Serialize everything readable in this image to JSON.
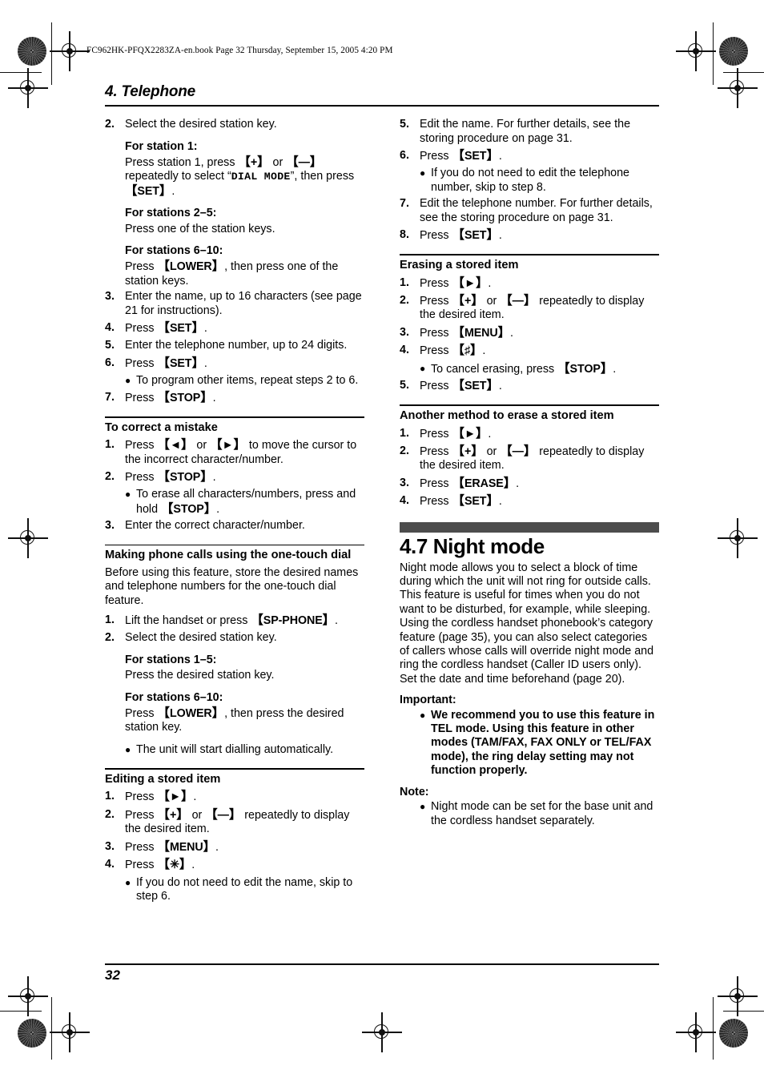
{
  "book_header": "FC962HK-PFQX2283ZA-en.book  Page 32  Thursday, September 15, 2005  4:20 PM",
  "chapter": {
    "title": "4. Telephone"
  },
  "folio": "32",
  "colors": {
    "feature_bar": "#4d4d4d",
    "rule": "#000000",
    "text": "#000000"
  },
  "keys": {
    "set": "SET",
    "stop": "STOP",
    "lower": "LOWER",
    "menu": "MENU",
    "erase": "ERASE",
    "sp_phone": "SP-PHONE",
    "plus": "+",
    "minus": "—",
    "left": "◄",
    "right": "►",
    "star": "✳",
    "hash": "♯"
  },
  "left_column": {
    "continued_steps": [
      {
        "num": "2.",
        "text": "Select the desired station key.",
        "substeps": [
          {
            "head": "For station 1:",
            "body_parts": [
              {
                "t": "text",
                "v": "Press station 1, press "
              },
              {
                "t": "key",
                "v": "+"
              },
              {
                "t": "text",
                "v": " or "
              },
              {
                "t": "key",
                "v": "—"
              },
              {
                "t": "text",
                "v": " repeatedly to select “"
              },
              {
                "t": "mono",
                "v": "DIAL MODE"
              },
              {
                "t": "text",
                "v": "”, then press "
              },
              {
                "t": "key",
                "v": "SET"
              },
              {
                "t": "text",
                "v": "."
              }
            ]
          },
          {
            "head": "For stations 2–5:",
            "body_parts": [
              {
                "t": "text",
                "v": "Press one of the station keys."
              }
            ]
          },
          {
            "head": "For stations 6–10:",
            "body_parts": [
              {
                "t": "text",
                "v": "Press "
              },
              {
                "t": "key",
                "v": "LOWER"
              },
              {
                "t": "text",
                "v": ", then press one of the station keys."
              }
            ]
          }
        ]
      },
      {
        "num": "3.",
        "text": "Enter the name, up to 16 characters (see page 21 for instructions)."
      },
      {
        "num": "4.",
        "parts": [
          {
            "t": "text",
            "v": "Press "
          },
          {
            "t": "key",
            "v": "SET"
          },
          {
            "t": "text",
            "v": "."
          }
        ]
      },
      {
        "num": "5.",
        "text": "Enter the telephone number, up to 24 digits."
      },
      {
        "num": "6.",
        "parts": [
          {
            "t": "text",
            "v": "Press "
          },
          {
            "t": "key",
            "v": "SET"
          },
          {
            "t": "text",
            "v": "."
          }
        ],
        "bullets": [
          {
            "parts": [
              {
                "t": "text",
                "v": "To program other items, repeat steps 2 to 6."
              }
            ]
          }
        ]
      },
      {
        "num": "7.",
        "parts": [
          {
            "t": "text",
            "v": "Press "
          },
          {
            "t": "key",
            "v": "STOP"
          },
          {
            "t": "text",
            "v": "."
          }
        ]
      }
    ],
    "sections": [
      {
        "heading": "To correct a mistake",
        "steps": [
          {
            "num": "1.",
            "parts": [
              {
                "t": "text",
                "v": "Press "
              },
              {
                "t": "key",
                "v": "◄"
              },
              {
                "t": "text",
                "v": " or "
              },
              {
                "t": "key",
                "v": "►"
              },
              {
                "t": "text",
                "v": " to move the cursor to the incorrect character/number."
              }
            ]
          },
          {
            "num": "2.",
            "parts": [
              {
                "t": "text",
                "v": "Press "
              },
              {
                "t": "key",
                "v": "STOP"
              },
              {
                "t": "text",
                "v": "."
              }
            ],
            "bullets": [
              {
                "parts": [
                  {
                    "t": "text",
                    "v": "To erase all characters/numbers, press and hold "
                  },
                  {
                    "t": "key",
                    "v": "STOP"
                  },
                  {
                    "t": "text",
                    "v": "."
                  }
                ]
              }
            ]
          },
          {
            "num": "3.",
            "text": "Enter the correct character/number."
          }
        ]
      },
      {
        "heading": "Making phone calls using the one-touch dial",
        "intro": "Before using this feature, store the desired names and telephone numbers for the one-touch dial feature.",
        "steps": [
          {
            "num": "1.",
            "parts": [
              {
                "t": "text",
                "v": "Lift the handset or press "
              },
              {
                "t": "key",
                "v": "SP-PHONE"
              },
              {
                "t": "text",
                "v": "."
              }
            ]
          },
          {
            "num": "2.",
            "text": "Select the desired station key.",
            "substeps": [
              {
                "head": "For stations 1–5:",
                "body_parts": [
                  {
                    "t": "text",
                    "v": "Press the desired station key."
                  }
                ]
              },
              {
                "head": "For stations 6–10:",
                "body_parts": [
                  {
                    "t": "text",
                    "v": "Press "
                  },
                  {
                    "t": "key",
                    "v": "LOWER"
                  },
                  {
                    "t": "text",
                    "v": ", then press the desired station key."
                  }
                ]
              }
            ],
            "trailing_bullets": [
              {
                "parts": [
                  {
                    "t": "text",
                    "v": "The unit will start dialling automatically."
                  }
                ]
              }
            ]
          }
        ]
      },
      {
        "heading": "Editing a stored item",
        "steps": [
          {
            "num": "1.",
            "parts": [
              {
                "t": "text",
                "v": "Press "
              },
              {
                "t": "key",
                "v": "►"
              },
              {
                "t": "text",
                "v": "."
              }
            ]
          },
          {
            "num": "2.",
            "parts": [
              {
                "t": "text",
                "v": "Press "
              },
              {
                "t": "key",
                "v": "+"
              },
              {
                "t": "text",
                "v": " or "
              },
              {
                "t": "key",
                "v": "—"
              },
              {
                "t": "text",
                "v": " repeatedly to display the desired item."
              }
            ]
          },
          {
            "num": "3.",
            "parts": [
              {
                "t": "text",
                "v": "Press "
              },
              {
                "t": "key",
                "v": "MENU"
              },
              {
                "t": "text",
                "v": "."
              }
            ]
          },
          {
            "num": "4.",
            "parts": [
              {
                "t": "text",
                "v": "Press "
              },
              {
                "t": "key",
                "v": "✳"
              },
              {
                "t": "text",
                "v": "."
              }
            ],
            "bullets": [
              {
                "parts": [
                  {
                    "t": "text",
                    "v": "If you do not need to edit the name, skip to step 6."
                  }
                ]
              }
            ]
          }
        ]
      }
    ]
  },
  "right_column": {
    "continued_steps": [
      {
        "num": "5.",
        "text": "Edit the name. For further details, see the storing procedure on page 31."
      },
      {
        "num": "6.",
        "parts": [
          {
            "t": "text",
            "v": "Press "
          },
          {
            "t": "key",
            "v": "SET"
          },
          {
            "t": "text",
            "v": "."
          }
        ],
        "bullets": [
          {
            "parts": [
              {
                "t": "text",
                "v": "If you do not need to edit the telephone number, skip to step 8."
              }
            ]
          }
        ]
      },
      {
        "num": "7.",
        "text": "Edit the telephone number. For further details, see the storing procedure on page 31."
      },
      {
        "num": "8.",
        "parts": [
          {
            "t": "text",
            "v": "Press "
          },
          {
            "t": "key",
            "v": "SET"
          },
          {
            "t": "text",
            "v": "."
          }
        ]
      }
    ],
    "sections": [
      {
        "heading": "Erasing a stored item",
        "steps": [
          {
            "num": "1.",
            "parts": [
              {
                "t": "text",
                "v": "Press "
              },
              {
                "t": "key",
                "v": "►"
              },
              {
                "t": "text",
                "v": "."
              }
            ]
          },
          {
            "num": "2.",
            "parts": [
              {
                "t": "text",
                "v": "Press "
              },
              {
                "t": "key",
                "v": "+"
              },
              {
                "t": "text",
                "v": " or "
              },
              {
                "t": "key",
                "v": "—"
              },
              {
                "t": "text",
                "v": " repeatedly to display the desired item."
              }
            ]
          },
          {
            "num": "3.",
            "parts": [
              {
                "t": "text",
                "v": "Press "
              },
              {
                "t": "key",
                "v": "MENU"
              },
              {
                "t": "text",
                "v": "."
              }
            ]
          },
          {
            "num": "4.",
            "parts": [
              {
                "t": "text",
                "v": "Press "
              },
              {
                "t": "key",
                "v": "♯"
              },
              {
                "t": "text",
                "v": "."
              }
            ],
            "bullets": [
              {
                "parts": [
                  {
                    "t": "text",
                    "v": "To cancel erasing, press "
                  },
                  {
                    "t": "key",
                    "v": "STOP"
                  },
                  {
                    "t": "text",
                    "v": "."
                  }
                ]
              }
            ]
          },
          {
            "num": "5.",
            "parts": [
              {
                "t": "text",
                "v": "Press "
              },
              {
                "t": "key",
                "v": "SET"
              },
              {
                "t": "text",
                "v": "."
              }
            ]
          }
        ]
      },
      {
        "heading": "Another method to erase a stored item",
        "steps": [
          {
            "num": "1.",
            "parts": [
              {
                "t": "text",
                "v": "Press "
              },
              {
                "t": "key",
                "v": "►"
              },
              {
                "t": "text",
                "v": "."
              }
            ]
          },
          {
            "num": "2.",
            "parts": [
              {
                "t": "text",
                "v": "Press "
              },
              {
                "t": "key",
                "v": "+"
              },
              {
                "t": "text",
                "v": " or "
              },
              {
                "t": "key",
                "v": "—"
              },
              {
                "t": "text",
                "v": " repeatedly to display the desired item."
              }
            ]
          },
          {
            "num": "3.",
            "parts": [
              {
                "t": "text",
                "v": "Press "
              },
              {
                "t": "key",
                "v": "ERASE"
              },
              {
                "t": "text",
                "v": "."
              }
            ]
          },
          {
            "num": "4.",
            "parts": [
              {
                "t": "text",
                "v": "Press "
              },
              {
                "t": "key",
                "v": "SET"
              },
              {
                "t": "text",
                "v": "."
              }
            ]
          }
        ]
      }
    ],
    "feature": {
      "number_title": "4.7 Night mode",
      "paragraphs": [
        "Night mode allows you to select a block of time during which the unit will not ring for outside calls. This feature is useful for times when you do not want to be disturbed, for example, while sleeping.",
        "Using the cordless handset phonebook’s category feature (page 35), you can also select categories of callers whose calls will override night mode and ring the cordless handset (Caller ID users only).",
        "Set the date and time beforehand (page 20)."
      ],
      "important_label": "Important:",
      "important_bullets": [
        "We recommend you to use this feature in TEL mode. Using this feature in other modes (TAM/FAX, FAX ONLY or TEL/FAX mode), the ring delay setting may not function properly."
      ],
      "note_label": "Note:",
      "note_bullets": [
        "Night mode can be set for the base unit and the cordless handset separately."
      ]
    }
  }
}
